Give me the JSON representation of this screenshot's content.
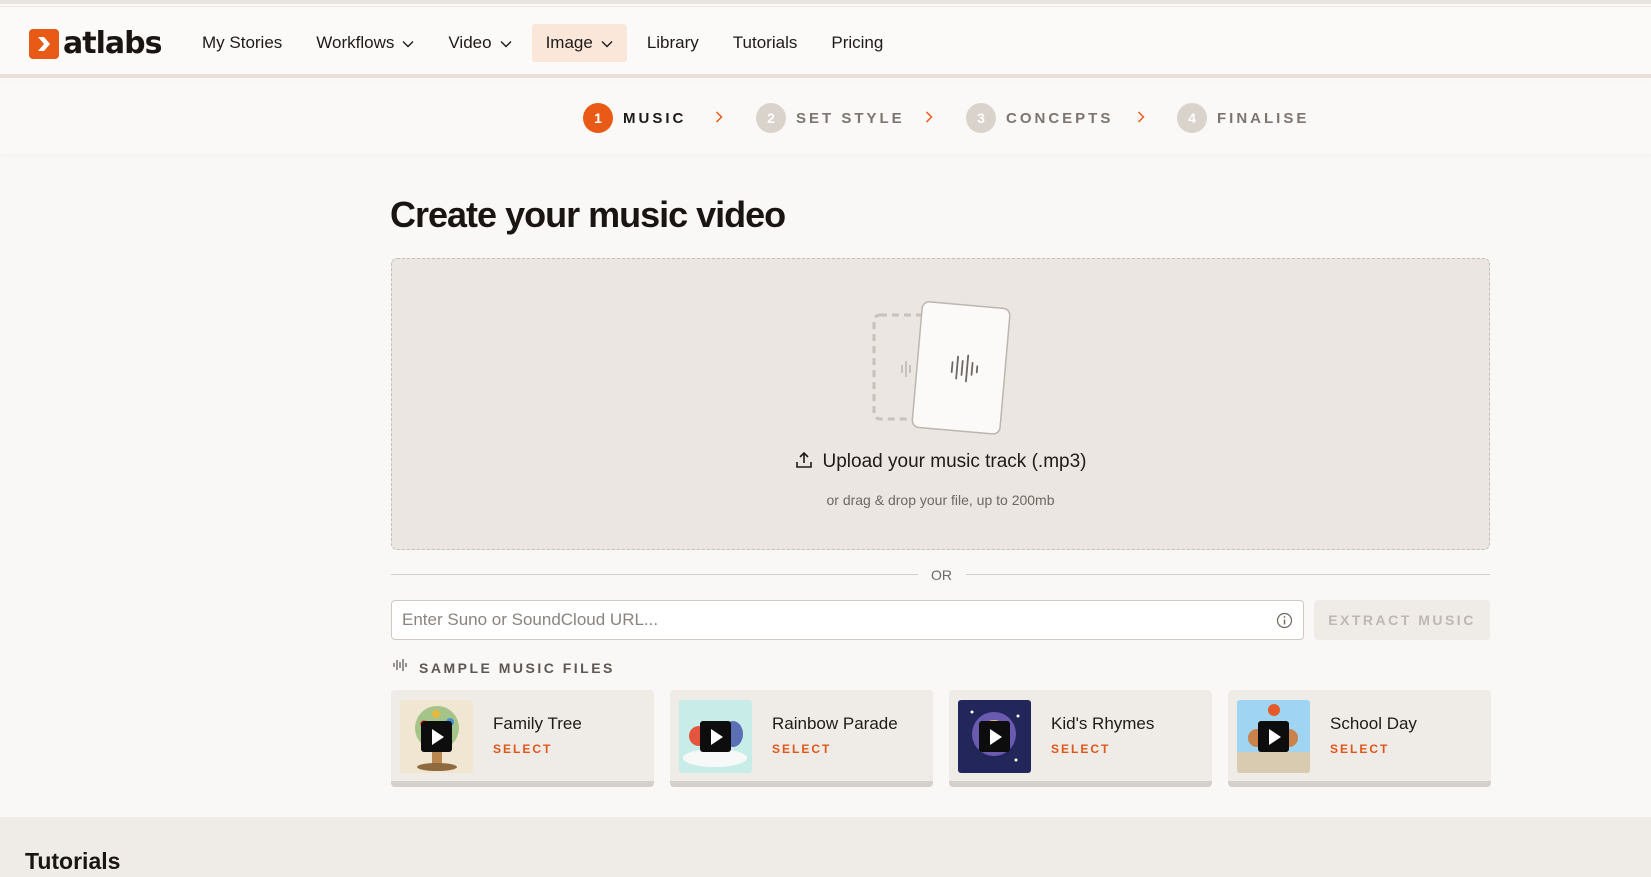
{
  "brand": {
    "name": "atlabs",
    "accent": "#ea5a17"
  },
  "nav": {
    "items": [
      {
        "label": "My Stories",
        "dropdown": false,
        "active": false
      },
      {
        "label": "Workflows",
        "dropdown": true,
        "active": false
      },
      {
        "label": "Video",
        "dropdown": true,
        "active": false
      },
      {
        "label": "Image",
        "dropdown": true,
        "active": true
      },
      {
        "label": "Library",
        "dropdown": false,
        "active": false
      },
      {
        "label": "Tutorials",
        "dropdown": false,
        "active": false
      },
      {
        "label": "Pricing",
        "dropdown": false,
        "active": false
      }
    ]
  },
  "steps": [
    {
      "num": "1",
      "label": "MUSIC",
      "active": true
    },
    {
      "num": "2",
      "label": "SET STYLE",
      "active": false
    },
    {
      "num": "3",
      "label": "CONCEPTS",
      "active": false
    },
    {
      "num": "4",
      "label": "FINALISE",
      "active": false
    }
  ],
  "main": {
    "title": "Create your music video",
    "upload_label": "Upload your music track (.mp3)",
    "upload_hint": "or drag & drop your file, up to 200mb",
    "or_text": "OR",
    "url_placeholder": "Enter Suno or SoundCloud URL...",
    "url_value": "",
    "extract_label": "EXTRACT MUSIC",
    "samples_label": "SAMPLE MUSIC FILES"
  },
  "samples": [
    {
      "name": "Family Tree",
      "select": "SELECT",
      "thumb_colors": [
        "#f1e6d2",
        "#b9874f",
        "#8e6a3f"
      ]
    },
    {
      "name": "Rainbow Parade",
      "select": "SELECT",
      "thumb_colors": [
        "#c8ece8",
        "#e4553d",
        "#5b6fb6"
      ]
    },
    {
      "name": "Kid's Rhymes",
      "select": "SELECT",
      "thumb_colors": [
        "#22265a",
        "#f1c46a",
        "#6a5ab0"
      ]
    },
    {
      "name": "School Day",
      "select": "SELECT",
      "thumb_colors": [
        "#9fd4f2",
        "#c9834a",
        "#e45a2a"
      ]
    }
  ],
  "footer": {
    "tutorials_title": "Tutorials"
  }
}
